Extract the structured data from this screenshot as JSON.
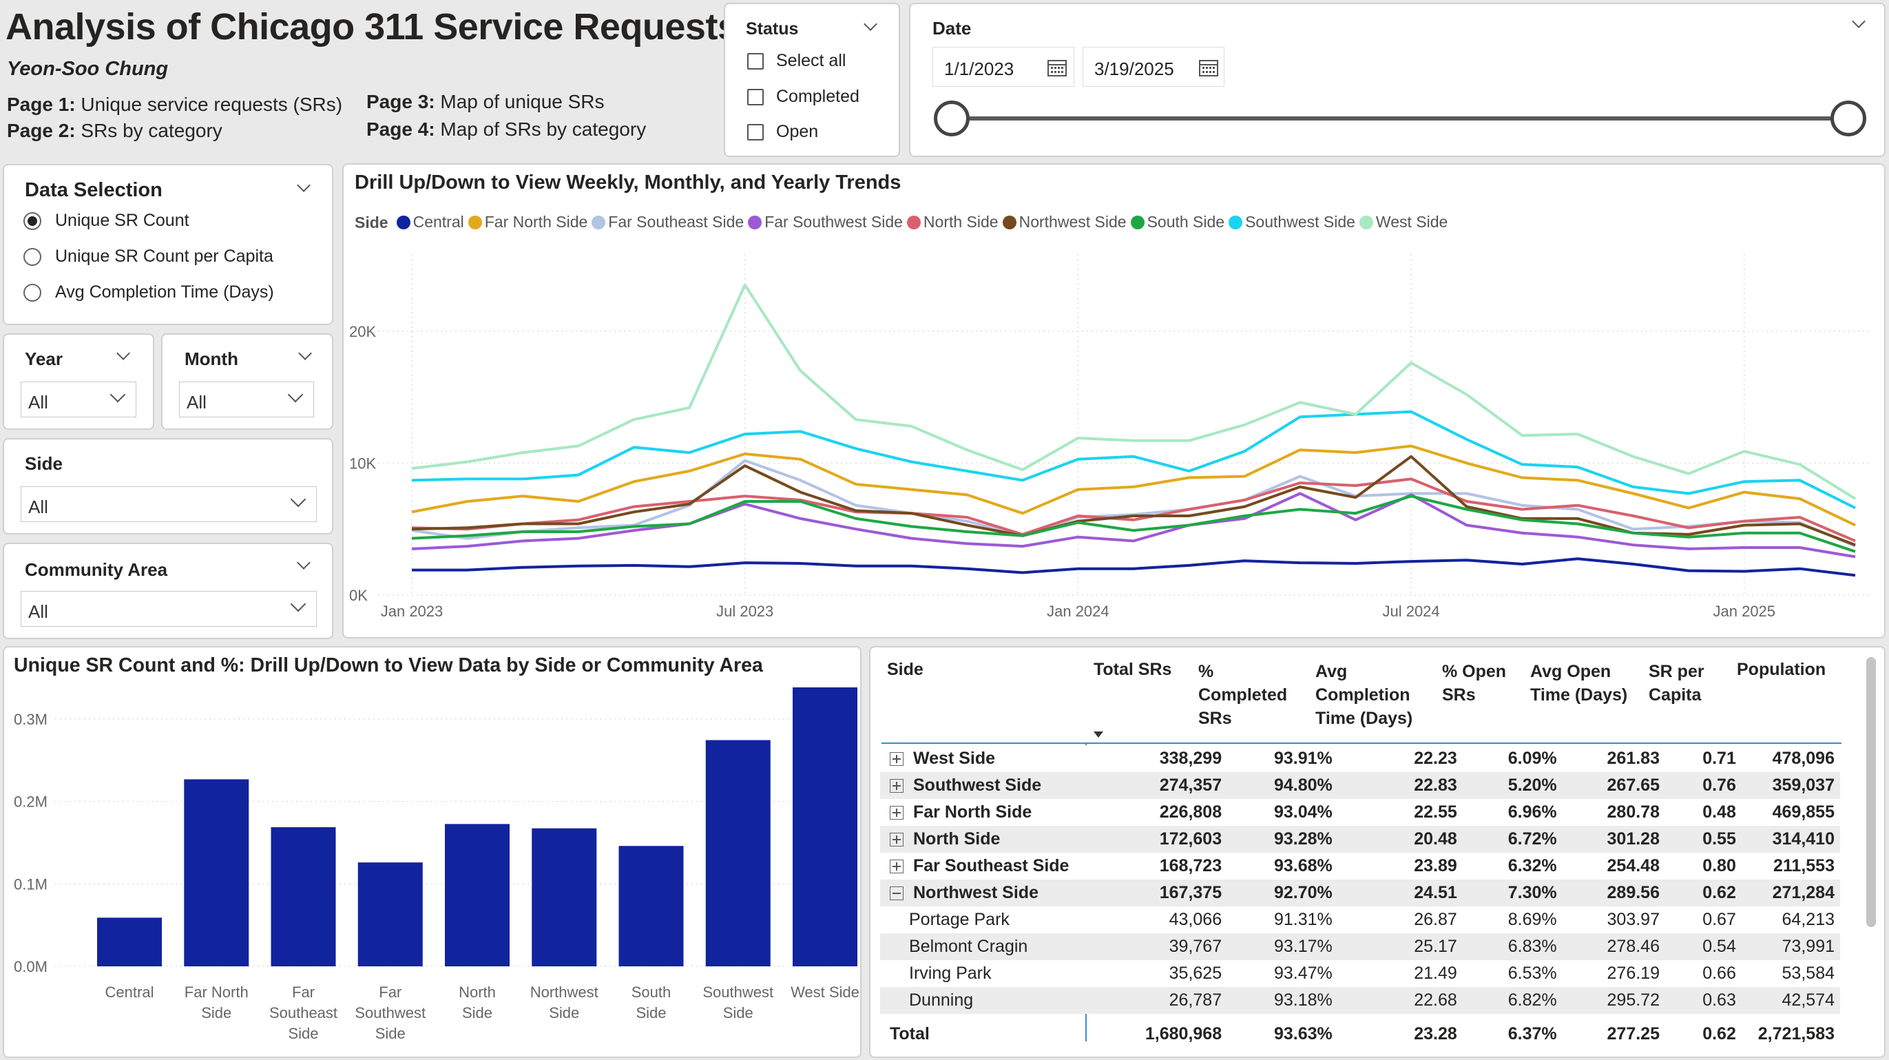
{
  "header": {
    "title": "Analysis of Chicago 311 Service Requests",
    "author": "Yeon-Soo Chung",
    "pages": [
      {
        "label": "Page 1:",
        "desc": "Unique service requests (SRs)"
      },
      {
        "label": "Page 2:",
        "desc": "SRs by category"
      },
      {
        "label": "Page 3:",
        "desc": "Map of unique SRs"
      },
      {
        "label": "Page 4:",
        "desc": "Map of SRs by category"
      }
    ]
  },
  "status_slicer": {
    "title": "Status",
    "options": [
      "Select all",
      "Completed",
      "Open"
    ]
  },
  "date_slicer": {
    "title": "Date",
    "start": "1/1/2023",
    "end": "3/19/2025"
  },
  "data_selection": {
    "title": "Data Selection",
    "options": [
      "Unique SR Count",
      "Unique SR Count per Capita",
      "Avg Completion Time (Days)"
    ],
    "selected": 0
  },
  "filters": {
    "year": {
      "title": "Year",
      "value": "All"
    },
    "month": {
      "title": "Month",
      "value": "All"
    },
    "side": {
      "title": "Side",
      "value": "All"
    },
    "community": {
      "title": "Community Area",
      "value": "All"
    }
  },
  "chart_data": [
    {
      "type": "line",
      "title": "Drill Up/Down to View Weekly, Monthly, and Yearly Trends",
      "legend_title": "Side",
      "legend_position": "top-left",
      "x": [
        "2023-01",
        "2023-02",
        "2023-03",
        "2023-04",
        "2023-05",
        "2023-06",
        "2023-07",
        "2023-08",
        "2023-09",
        "2023-10",
        "2023-11",
        "2023-12",
        "2024-01",
        "2024-02",
        "2024-03",
        "2024-04",
        "2024-05",
        "2024-06",
        "2024-07",
        "2024-08",
        "2024-09",
        "2024-10",
        "2024-11",
        "2024-12",
        "2025-01",
        "2025-02",
        "2025-03"
      ],
      "x_ticks": [
        "Jan 2023",
        "Jul 2023",
        "Jan 2024",
        "Jul 2024",
        "Jan 2025"
      ],
      "y_ticks": [
        "0K",
        "10K",
        "20K"
      ],
      "ylim": [
        0,
        25000
      ],
      "grid": true,
      "series": [
        {
          "name": "Central",
          "color": "#12239e",
          "values": [
            1900,
            1900,
            2100,
            2200,
            2250,
            2150,
            2450,
            2400,
            2200,
            2200,
            2000,
            1700,
            2000,
            2000,
            2250,
            2600,
            2450,
            2400,
            2550,
            2650,
            2350,
            2750,
            2350,
            1850,
            1800,
            2000,
            1500
          ]
        },
        {
          "name": "Far North Side",
          "color": "#e2a91b",
          "values": [
            6300,
            7100,
            7500,
            7100,
            8600,
            9400,
            10700,
            10300,
            8400,
            8000,
            7600,
            6200,
            8000,
            8200,
            8900,
            9000,
            11000,
            10800,
            11300,
            10000,
            8900,
            8700,
            7700,
            6600,
            7800,
            7300,
            5300
          ]
        },
        {
          "name": "Far Southeast Side",
          "color": "#b3c3e5",
          "values": [
            4900,
            4300,
            4800,
            5100,
            5300,
            6800,
            10200,
            8700,
            6800,
            6200,
            5600,
            4500,
            5900,
            6100,
            6500,
            7200,
            9000,
            7500,
            7700,
            7700,
            6800,
            6500,
            5000,
            5200,
            5600,
            5500,
            3700
          ]
        },
        {
          "name": "Far Southwest Side",
          "color": "#9d59d6",
          "values": [
            3500,
            3700,
            4100,
            4300,
            4900,
            5400,
            6900,
            5800,
            5000,
            4300,
            3900,
            3700,
            4400,
            4100,
            5300,
            5800,
            7700,
            5700,
            7600,
            5300,
            4700,
            4400,
            3800,
            3500,
            3600,
            3600,
            2900
          ]
        },
        {
          "name": "North Side",
          "color": "#d9606e",
          "values": [
            5100,
            5000,
            5400,
            5700,
            6700,
            7100,
            7500,
            7200,
            6300,
            6200,
            5900,
            4600,
            6000,
            5700,
            6500,
            7200,
            8500,
            8300,
            8800,
            7100,
            6500,
            6800,
            6000,
            5100,
            5600,
            5900,
            4100
          ]
        },
        {
          "name": "Northwest Side",
          "color": "#744a1e",
          "values": [
            5000,
            5100,
            5400,
            5400,
            6300,
            6900,
            9800,
            7800,
            6400,
            6200,
            5300,
            4500,
            5600,
            6000,
            6000,
            6700,
            8200,
            7400,
            10500,
            6700,
            5800,
            5800,
            4700,
            4600,
            5300,
            5400,
            3800
          ]
        },
        {
          "name": "South Side",
          "color": "#1fa744",
          "values": [
            4300,
            4500,
            4800,
            4800,
            5200,
            5400,
            7100,
            7100,
            5800,
            5200,
            4800,
            4500,
            5500,
            4900,
            5300,
            6000,
            6500,
            6200,
            7500,
            6500,
            5700,
            5400,
            4700,
            4400,
            4700,
            4700,
            3300
          ]
        },
        {
          "name": "Southwest Side",
          "color": "#1bd3f0",
          "values": [
            8700,
            8800,
            8800,
            9100,
            11200,
            10800,
            12200,
            12400,
            11100,
            10100,
            9400,
            8700,
            10300,
            10500,
            9400,
            10900,
            13500,
            13700,
            13900,
            11800,
            9900,
            9700,
            8200,
            7700,
            8600,
            8700,
            6600
          ]
        },
        {
          "name": "West Side",
          "color": "#a8e8c2",
          "values": [
            9600,
            10100,
            10800,
            11300,
            13300,
            14200,
            23500,
            17000,
            13300,
            12800,
            11000,
            9500,
            11900,
            11700,
            11700,
            12900,
            14600,
            13700,
            17600,
            15200,
            12100,
            12200,
            10500,
            9200,
            10900,
            9900,
            7300
          ]
        }
      ]
    },
    {
      "type": "bar",
      "title": "Unique SR Count and %: Drill Up/Down to View Data by Side or Community Area",
      "categories": [
        "Central",
        "Far North Side",
        "Far Southeast Side",
        "Far Southwest Side",
        "North Side",
        "Northwest Side",
        "South Side",
        "Southwest Side",
        "West Side"
      ],
      "values": [
        59000,
        226808,
        168723,
        126000,
        172603,
        167375,
        146000,
        274357,
        338299
      ],
      "y_ticks": [
        "0.0M",
        "0.1M",
        "0.2M",
        "0.3M"
      ],
      "ylim": [
        0,
        350000
      ],
      "color": "#12239e",
      "grid": true
    },
    {
      "type": "table",
      "columns": [
        "Side",
        "Total SRs",
        "% Completed SRs",
        "Avg Completion Time (Days)",
        "% Open SRs",
        "Avg Open Time (Days)",
        "SR per Capita",
        "Population"
      ],
      "sorted_column": "Total SRs",
      "rows": [
        {
          "level": 0,
          "expand": "+",
          "cells": [
            "West Side",
            "338,299",
            "93.91%",
            "22.23",
            "6.09%",
            "261.83",
            "0.71",
            "478,096"
          ]
        },
        {
          "level": 0,
          "expand": "+",
          "cells": [
            "Southwest Side",
            "274,357",
            "94.80%",
            "22.83",
            "5.20%",
            "267.65",
            "0.76",
            "359,037"
          ]
        },
        {
          "level": 0,
          "expand": "+",
          "cells": [
            "Far North Side",
            "226,808",
            "93.04%",
            "22.55",
            "6.96%",
            "280.78",
            "0.48",
            "469,855"
          ]
        },
        {
          "level": 0,
          "expand": "+",
          "cells": [
            "North Side",
            "172,603",
            "93.28%",
            "20.48",
            "6.72%",
            "301.28",
            "0.55",
            "314,410"
          ]
        },
        {
          "level": 0,
          "expand": "+",
          "cells": [
            "Far Southeast Side",
            "168,723",
            "93.68%",
            "23.89",
            "6.32%",
            "254.48",
            "0.80",
            "211,553"
          ]
        },
        {
          "level": 0,
          "expand": "-",
          "cells": [
            "Northwest Side",
            "167,375",
            "92.70%",
            "24.51",
            "7.30%",
            "289.56",
            "0.62",
            "271,284"
          ]
        },
        {
          "level": 1,
          "expand": "",
          "cells": [
            "Portage Park",
            "43,066",
            "91.31%",
            "26.87",
            "8.69%",
            "303.97",
            "0.67",
            "64,213"
          ]
        },
        {
          "level": 1,
          "expand": "",
          "cells": [
            "Belmont Cragin",
            "39,767",
            "93.17%",
            "25.17",
            "6.83%",
            "278.46",
            "0.54",
            "73,991"
          ]
        },
        {
          "level": 1,
          "expand": "",
          "cells": [
            "Irving Park",
            "35,625",
            "93.47%",
            "21.49",
            "6.53%",
            "276.19",
            "0.66",
            "53,584"
          ]
        },
        {
          "level": 1,
          "expand": "",
          "cells": [
            "Dunning",
            "26,787",
            "93.18%",
            "22.68",
            "6.82%",
            "295.72",
            "0.63",
            "42,574"
          ]
        }
      ],
      "total": [
        "Total",
        "1,680,968",
        "93.63%",
        "23.28",
        "6.37%",
        "277.25",
        "0.62",
        "2,721,583"
      ]
    }
  ]
}
